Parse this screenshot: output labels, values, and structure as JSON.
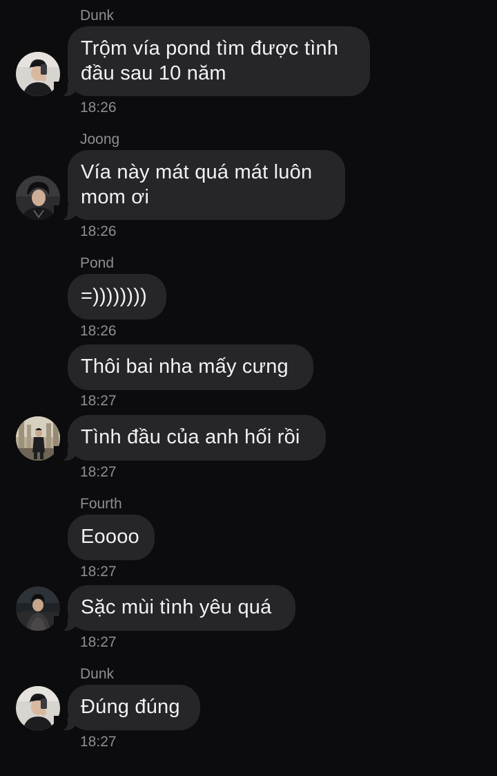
{
  "messages": [
    {
      "sender": "Dunk",
      "text": "Trộm vía pond tìm được tình\nđầu sau 10 năm",
      "time": "18:26",
      "avatar": "dunk-avatar"
    },
    {
      "sender": "Joong",
      "text": "Vía này mát quá mát luôn\nmom ơi",
      "time": "18:26",
      "avatar": "joong-avatar"
    },
    {
      "sender": "Pond",
      "text": "=))))))))",
      "time": "18:26"
    },
    {
      "text": "Thôi bai nha mấy cưng",
      "time": "18:27"
    },
    {
      "text": "Tình đầu của anh hối rồi",
      "time": "18:27",
      "avatar": "pond-avatar"
    },
    {
      "sender": "Fourth",
      "text": "Eoooo",
      "time": "18:27"
    },
    {
      "text": "Sặc mùi tình yêu quá",
      "time": "18:27",
      "avatar": "fourth-avatar"
    },
    {
      "sender": "Dunk",
      "text": "Đúng đúng",
      "time": "18:27",
      "avatar": "dunk-avatar"
    }
  ],
  "colors": {
    "background": "#0c0c0e",
    "bubble": "#262628",
    "bubble_text": "#f2f2f4",
    "meta_text": "#8e8e93"
  }
}
